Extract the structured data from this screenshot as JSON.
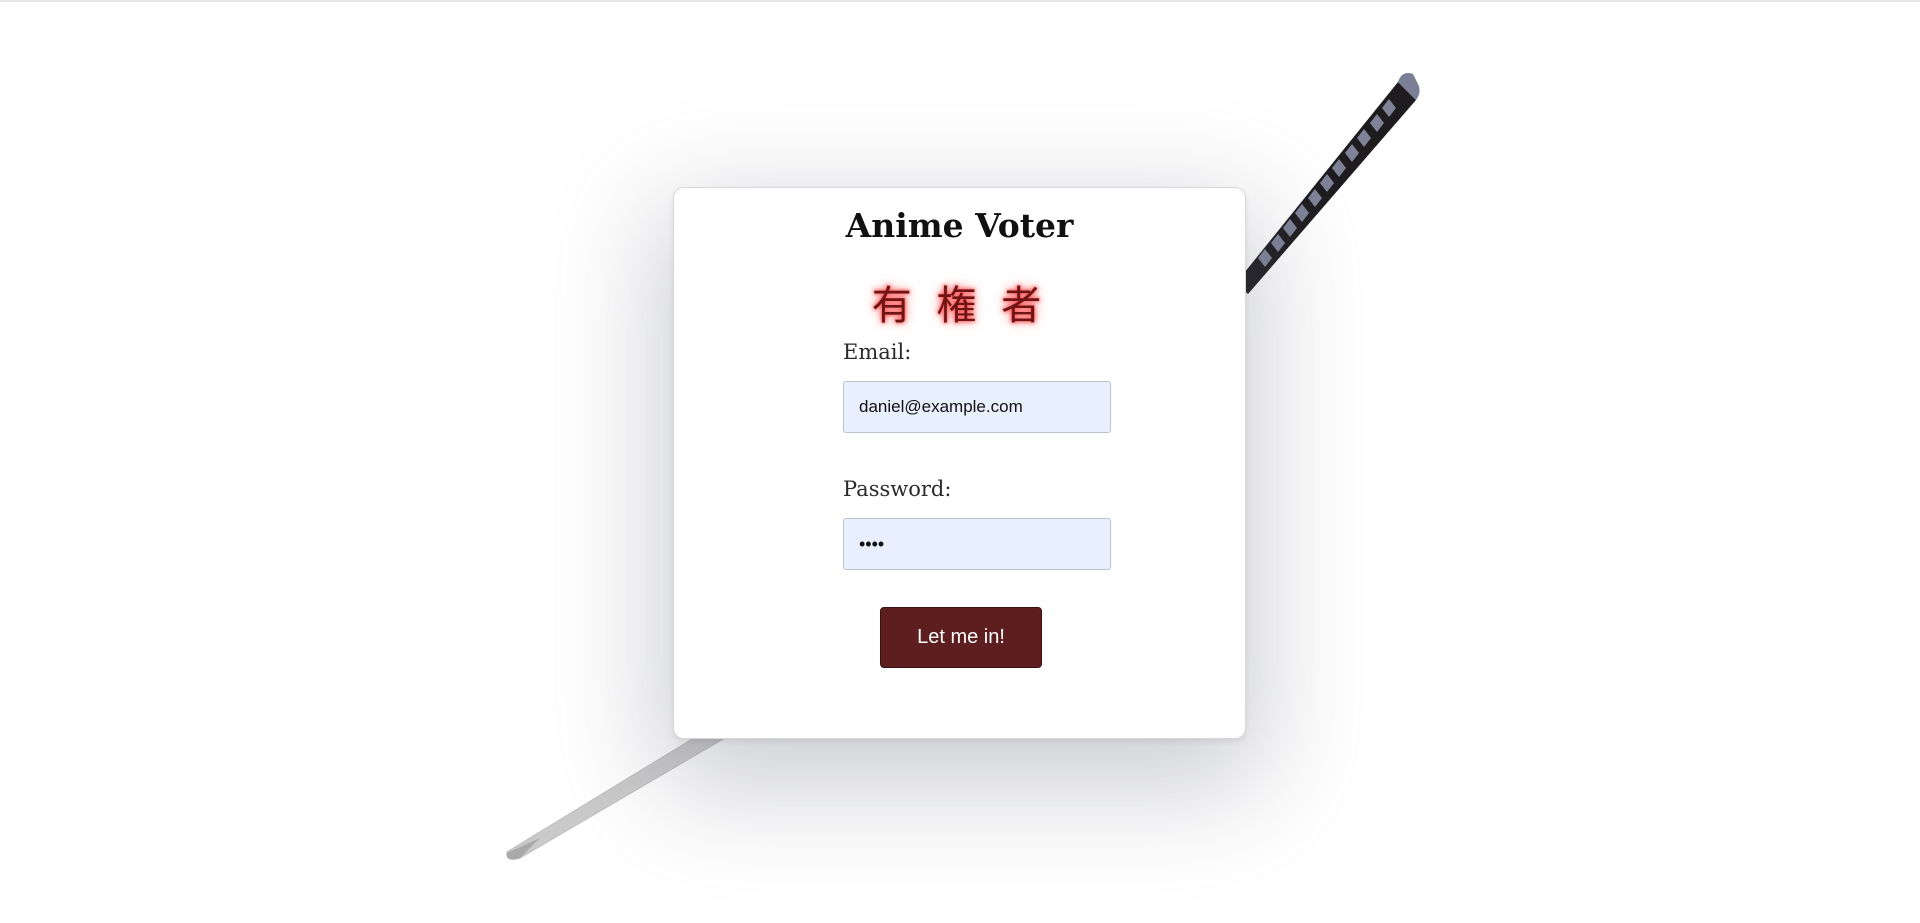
{
  "app": {
    "title": "Anime Voter",
    "subtitle": "有 権 者"
  },
  "form": {
    "email_label": "Email:",
    "email_value": "daniel@example.com",
    "password_label": "Password:",
    "password_value": "••••",
    "submit_label": "Let me in!"
  },
  "colors": {
    "button": "#5c1e1f",
    "input_bg": "#e8f0fe",
    "subtitle_glow": "#ff5a5a"
  },
  "icons": {
    "background": "katana-illustration"
  }
}
